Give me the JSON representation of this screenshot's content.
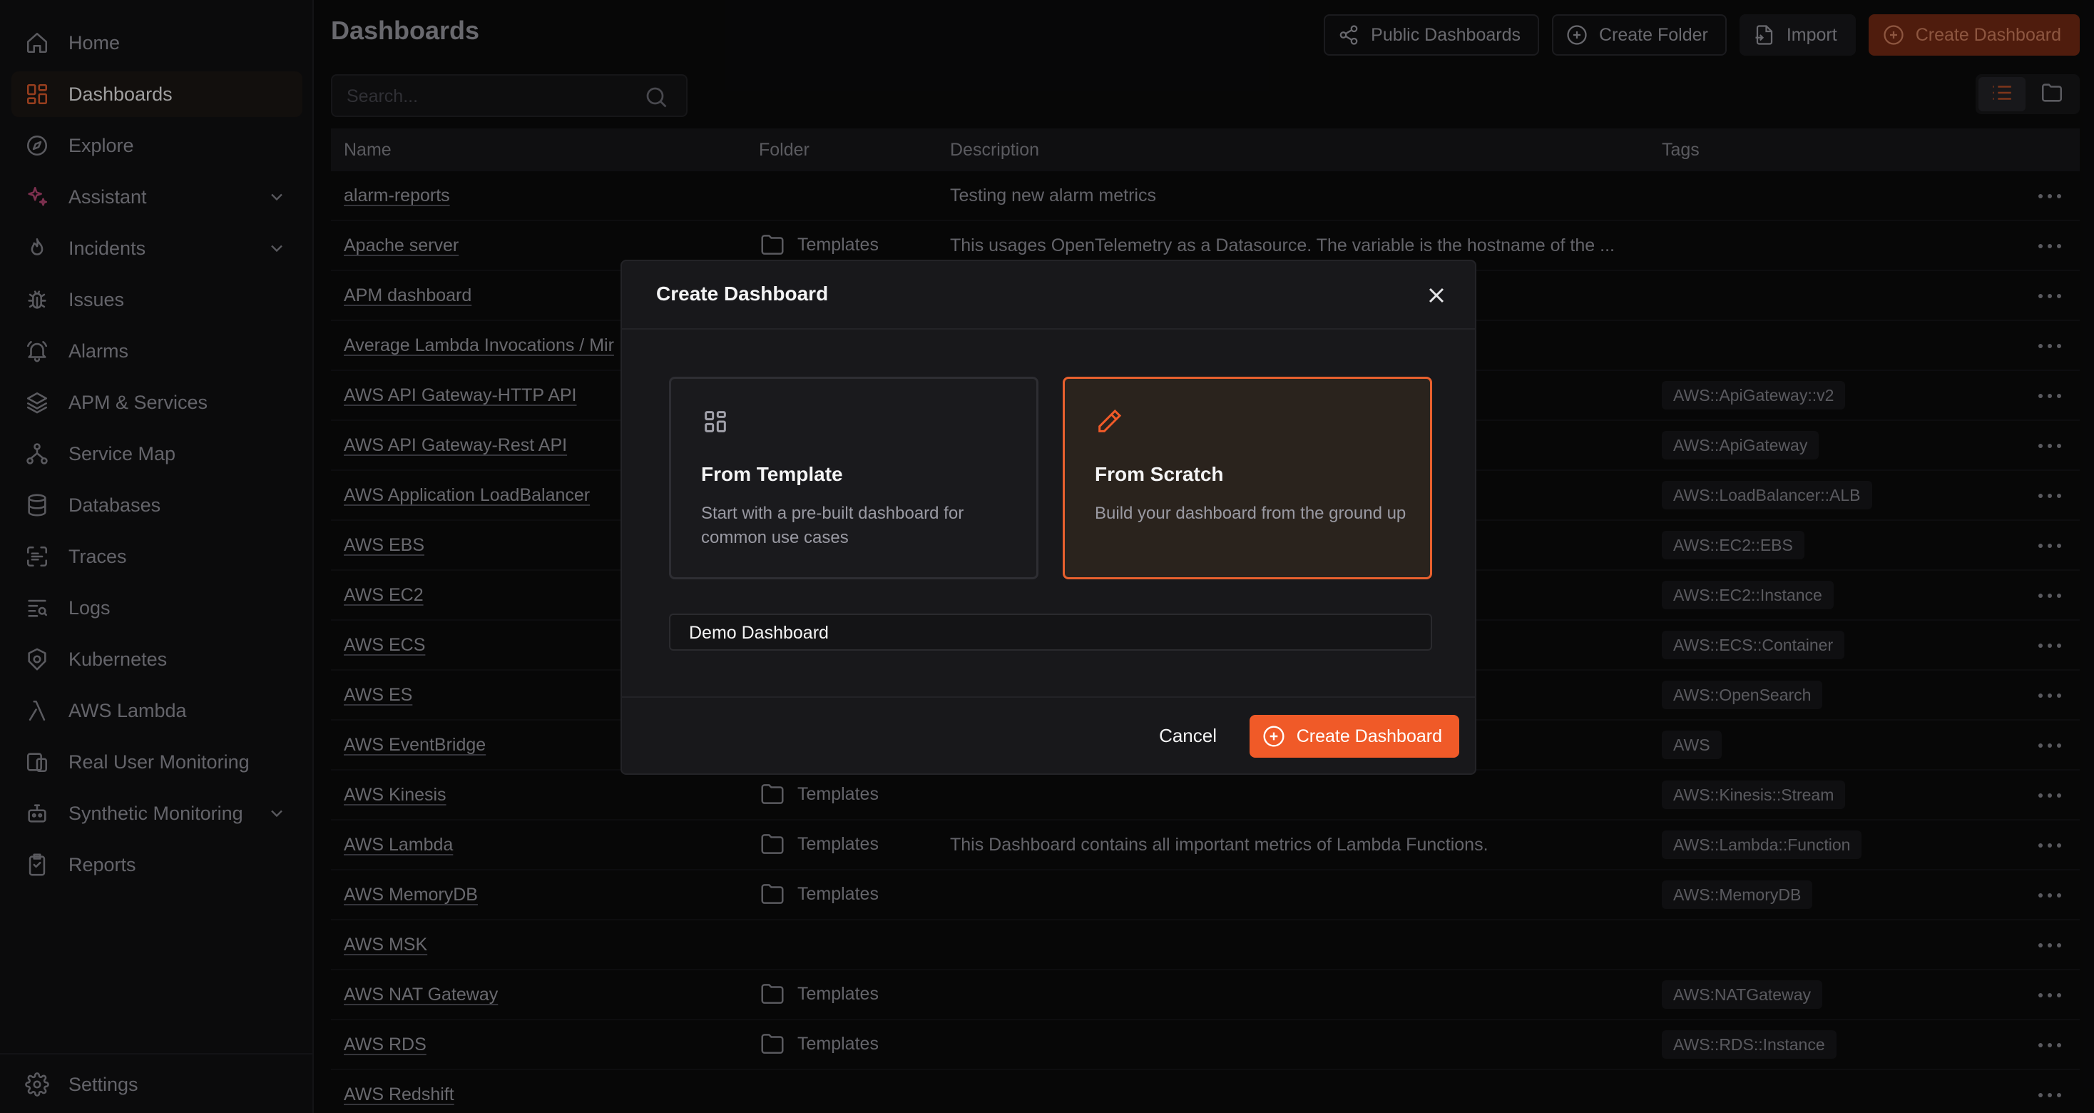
{
  "sidebar": {
    "items": [
      {
        "label": "Home",
        "icon": "home-icon"
      },
      {
        "label": "Dashboards",
        "icon": "dashboards-icon",
        "active": true
      },
      {
        "label": "Explore",
        "icon": "compass-icon"
      },
      {
        "label": "Assistant",
        "icon": "sparkles-icon",
        "expandable": true
      },
      {
        "label": "Incidents",
        "icon": "flame-icon",
        "expandable": true
      },
      {
        "label": "Issues",
        "icon": "bug-icon"
      },
      {
        "label": "Alarms",
        "icon": "bell-icon"
      },
      {
        "label": "APM & Services",
        "icon": "layers-icon"
      },
      {
        "label": "Service Map",
        "icon": "network-icon"
      },
      {
        "label": "Databases",
        "icon": "database-icon"
      },
      {
        "label": "Traces",
        "icon": "scan-icon"
      },
      {
        "label": "Logs",
        "icon": "logs-icon"
      },
      {
        "label": "Kubernetes",
        "icon": "kubernetes-icon"
      },
      {
        "label": "AWS Lambda",
        "icon": "lambda-icon"
      },
      {
        "label": "Real User Monitoring",
        "icon": "rum-icon"
      },
      {
        "label": "Synthetic Monitoring",
        "icon": "robot-icon",
        "expandable": true
      },
      {
        "label": "Reports",
        "icon": "clipboard-icon"
      }
    ],
    "settings_label": "Settings"
  },
  "header": {
    "title": "Dashboards",
    "public_dashboards": "Public Dashboards",
    "create_folder": "Create Folder",
    "import": "Import",
    "create_dashboard": "Create Dashboard"
  },
  "search": {
    "placeholder": "Search..."
  },
  "table": {
    "columns": {
      "name": "Name",
      "folder": "Folder",
      "description": "Description",
      "tags": "Tags"
    },
    "rows": [
      {
        "name": "alarm-reports",
        "folder": "",
        "description": "Testing new alarm metrics",
        "tag": ""
      },
      {
        "name": "Apache server",
        "folder": "Templates",
        "description": "This usages OpenTelemetry as a Datasource. The variable is the hostname of the ...",
        "tag": ""
      },
      {
        "name": "APM dashboard",
        "folder": "",
        "description": "",
        "tag": ""
      },
      {
        "name": "Average Lambda Invocations / Mir",
        "folder": "",
        "description": "",
        "tag": ""
      },
      {
        "name": "AWS API Gateway-HTTP API",
        "folder": "",
        "description": "",
        "tag": "AWS::ApiGateway::v2"
      },
      {
        "name": "AWS API Gateway-Rest API",
        "folder": "",
        "description": "",
        "tag": "AWS::ApiGateway"
      },
      {
        "name": "AWS Application LoadBalancer",
        "folder": "",
        "description": "",
        "tag": "AWS::LoadBalancer::ALB"
      },
      {
        "name": "AWS EBS",
        "folder": "",
        "description": "",
        "tag": "AWS::EC2::EBS"
      },
      {
        "name": "AWS EC2",
        "folder": "",
        "description": "",
        "tag": "AWS::EC2::Instance"
      },
      {
        "name": "AWS ECS",
        "folder": "",
        "description": "",
        "tag": "AWS::ECS::Container"
      },
      {
        "name": "AWS ES",
        "folder": "",
        "description": "",
        "tag": "AWS::OpenSearch"
      },
      {
        "name": "AWS EventBridge",
        "folder": "",
        "description": "",
        "tag": "AWS"
      },
      {
        "name": "AWS Kinesis",
        "folder": "Templates",
        "description": "",
        "tag": "AWS::Kinesis::Stream"
      },
      {
        "name": "AWS Lambda",
        "folder": "Templates",
        "description": "This Dashboard contains all important metrics of Lambda Functions.",
        "tag": "AWS::Lambda::Function"
      },
      {
        "name": "AWS MemoryDB",
        "folder": "Templates",
        "description": "",
        "tag": "AWS::MemoryDB"
      },
      {
        "name": "AWS MSK",
        "folder": "",
        "description": "",
        "tag": ""
      },
      {
        "name": "AWS NAT Gateway",
        "folder": "Templates",
        "description": "",
        "tag": "AWS:NATGateway"
      },
      {
        "name": "AWS RDS",
        "folder": "Templates",
        "description": "",
        "tag": "AWS::RDS::Instance"
      },
      {
        "name": "AWS Redshift",
        "folder": "",
        "description": "",
        "tag": ""
      }
    ]
  },
  "modal": {
    "title": "Create Dashboard",
    "template_title": "From Template",
    "template_desc": "Start with a pre-built dashboard for common use cases",
    "scratch_title": "From Scratch",
    "scratch_desc": "Build your dashboard from the ground up",
    "name_value": "Demo Dashboard",
    "cancel_label": "Cancel",
    "create_label": "Create Dashboard"
  },
  "colors": {
    "accent": "#f05a28",
    "background": "#0b0b0c",
    "sidebar": "#111113"
  }
}
